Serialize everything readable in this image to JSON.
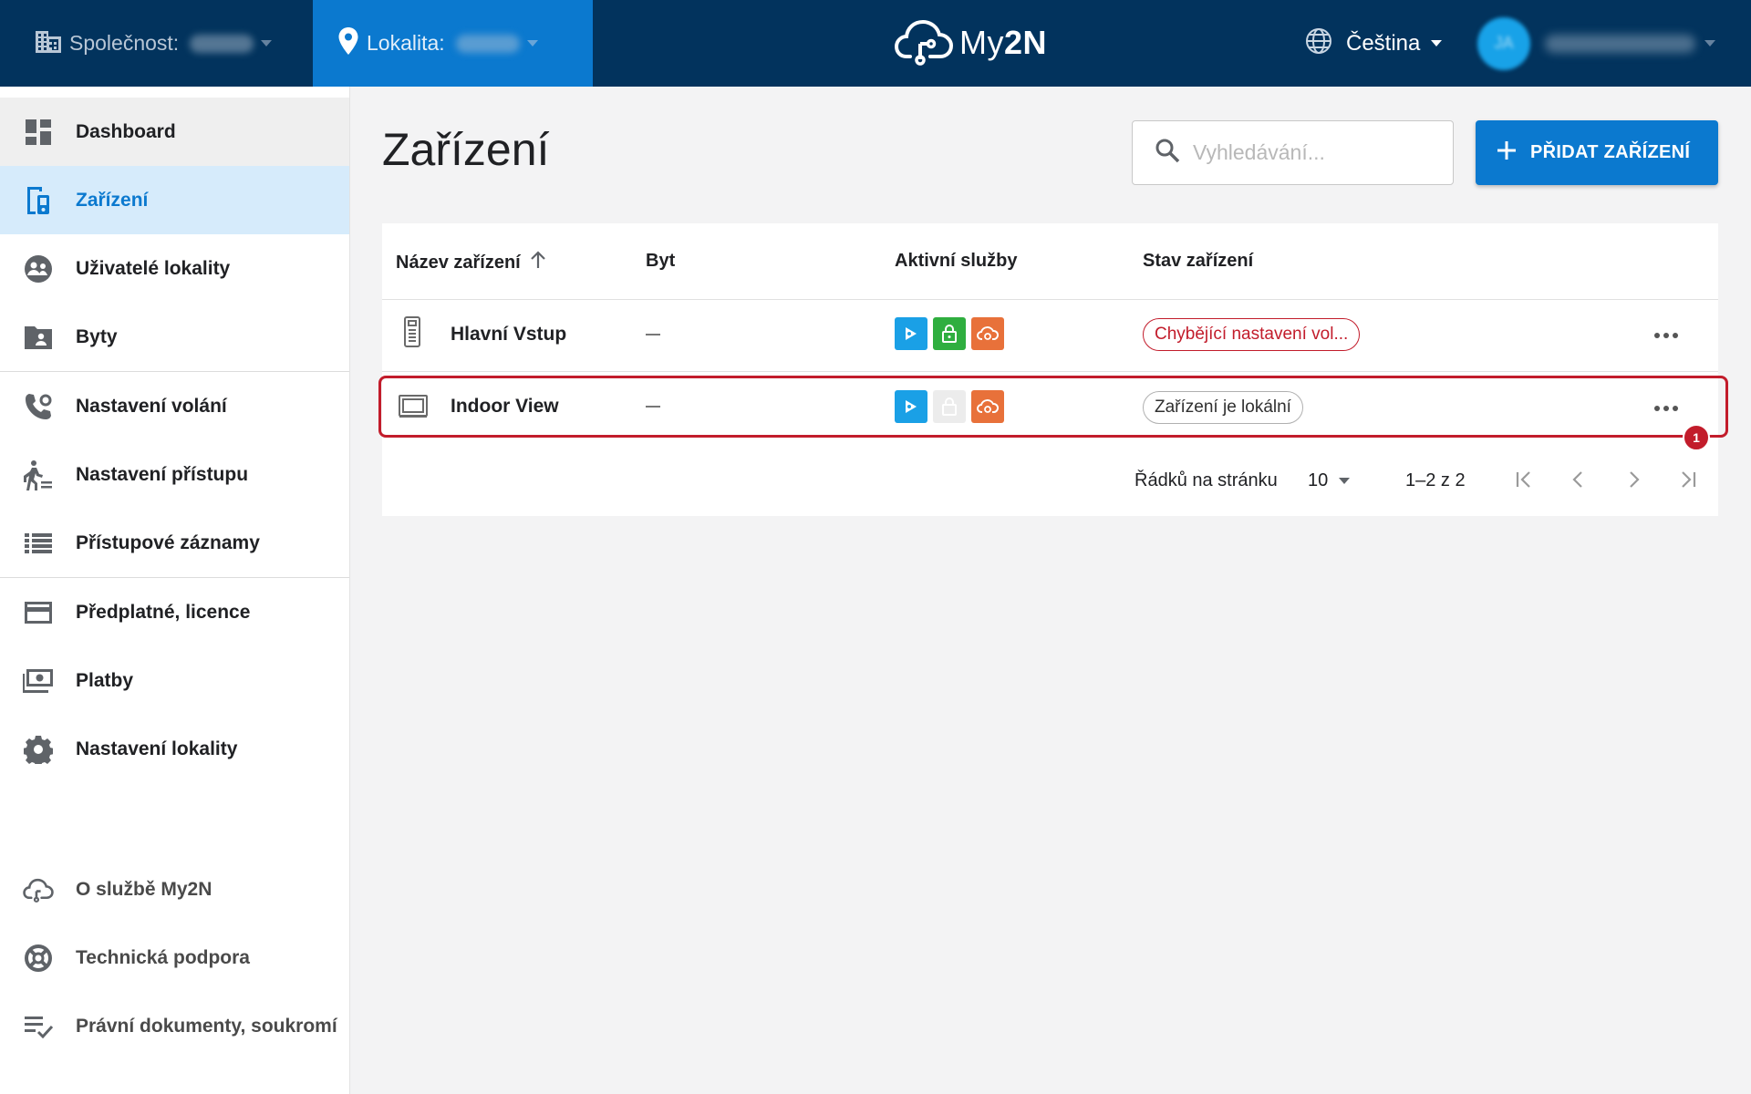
{
  "topbar": {
    "company_label": "Společnost:",
    "location_label": "Lokalita:",
    "logo_text_light": "My",
    "logo_text_bold": "2N",
    "language": "Čeština",
    "avatar_initials": "JA"
  },
  "sidebar": {
    "items": [
      {
        "label": "Dashboard",
        "icon": "dashboard-icon"
      },
      {
        "label": "Zařízení",
        "icon": "device-icon"
      },
      {
        "label": "Uživatelé lokality",
        "icon": "users-icon"
      },
      {
        "label": "Byty",
        "icon": "folder-person-icon"
      },
      {
        "label": "Nastavení volání",
        "icon": "phone-settings-icon"
      },
      {
        "label": "Nastavení přístupu",
        "icon": "access-walk-icon"
      },
      {
        "label": "Přístupové záznamy",
        "icon": "list-icon"
      },
      {
        "label": "Předplatné, licence",
        "icon": "card-icon"
      },
      {
        "label": "Platby",
        "icon": "payments-icon"
      },
      {
        "label": "Nastavení lokality",
        "icon": "gear-icon"
      }
    ],
    "footer": [
      {
        "label": "O službě My2N",
        "icon": "cloud-icon"
      },
      {
        "label": "Technická podpora",
        "icon": "lifebuoy-icon"
      },
      {
        "label": "Právní dokumenty, soukromí",
        "icon": "doc-check-icon"
      }
    ]
  },
  "main": {
    "title": "Zařízení",
    "search_placeholder": "Vyhledávání...",
    "add_button": "PŘIDAT ZAŘÍZENÍ"
  },
  "table": {
    "columns": [
      "Název zařízení",
      "Byt",
      "Aktivní služby",
      "Stav zařízení"
    ],
    "sort_icon": "arrow-up-icon",
    "rows": [
      {
        "name": "Hlavní Vstup",
        "device_icon": "intercom-icon",
        "apartment": "—",
        "services": [
          "mobile-video",
          "access-unlock",
          "remote-config"
        ],
        "status": "Chybějící nastavení vol...",
        "status_type": "error"
      },
      {
        "name": "Indoor View",
        "device_icon": "indoor-monitor-icon",
        "apartment": "—",
        "services": [
          "mobile-video",
          "access-unlock-disabled",
          "remote-config"
        ],
        "status": "Zařízení je lokální",
        "status_type": "info"
      }
    ],
    "highlight_badge": "1"
  },
  "pagination": {
    "rows_per_page_label": "Řádků na stránku",
    "rows_per_page": "10",
    "range": "1–2 z 2"
  },
  "colors": {
    "topbar": "#02335d",
    "accent": "#0b79cf",
    "active_nav_bg": "#d6ebfb",
    "error": "#c21c2b",
    "service_blue": "#1aa0e6",
    "service_green": "#2fae3f",
    "service_orange": "#e8713a"
  }
}
